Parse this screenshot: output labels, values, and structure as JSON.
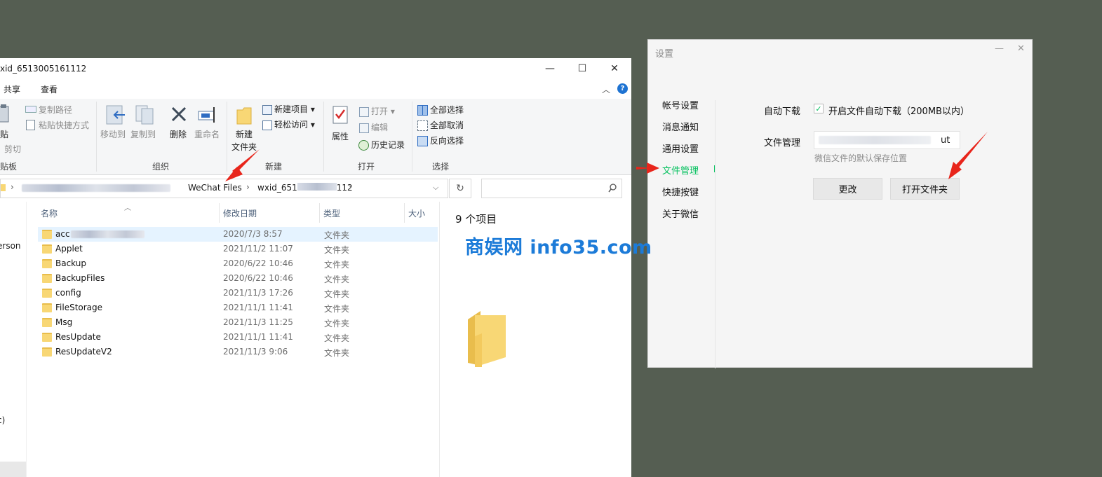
{
  "explorer": {
    "title": "xid_6513005161112",
    "window_controls": [
      "—",
      "☐",
      "✕"
    ],
    "tabs": [
      "共享",
      "查看"
    ],
    "ribbon": {
      "clipboard": {
        "paste": "贴",
        "copy_path": "复制路径",
        "paste_shortcut": "粘贴快捷方式",
        "cut": "剪切",
        "group_label": "贴板"
      },
      "organize": {
        "move_to": "移动到",
        "copy_to": "复制到",
        "delete": "删除",
        "rename": "重命名",
        "group_label": "组织"
      },
      "new": {
        "new_item": "新建项目",
        "easy_access": "轻松访问",
        "new_folder_1": "新建",
        "new_folder_2": "文件夹",
        "group_label": "新建"
      },
      "open": {
        "properties": "属性",
        "open": "打开",
        "edit": "编辑",
        "history": "历史记录",
        "group_label": "打开"
      },
      "select": {
        "select_all": "全部选择",
        "select_none": "全部取消",
        "invert": "反向选择",
        "group_label": "选择"
      }
    },
    "address": {
      "segment_wechat": "WeChat Files",
      "segment_wxid_a": "wxid_651",
      "segment_wxid_b": "112",
      "sep": "›"
    },
    "columns": {
      "name": "名称",
      "date": "修改日期",
      "type": "类型",
      "size": "大小"
    },
    "nav_fragments": [
      "erson",
      "c)"
    ],
    "files": [
      {
        "name": "acc",
        "date": "2020/7/3 8:57",
        "type": "文件夹",
        "selected": true
      },
      {
        "name": "Applet",
        "date": "2021/11/2 11:07",
        "type": "文件夹"
      },
      {
        "name": "Backup",
        "date": "2020/6/22 10:46",
        "type": "文件夹"
      },
      {
        "name": "BackupFiles",
        "date": "2020/6/22 10:46",
        "type": "文件夹"
      },
      {
        "name": "config",
        "date": "2021/11/3 17:26",
        "type": "文件夹"
      },
      {
        "name": "FileStorage",
        "date": "2021/11/1 11:41",
        "type": "文件夹"
      },
      {
        "name": "Msg",
        "date": "2021/11/3 11:25",
        "type": "文件夹"
      },
      {
        "name": "ResUpdate",
        "date": "2021/11/1 11:41",
        "type": "文件夹"
      },
      {
        "name": "ResUpdateV2",
        "date": "2021/11/3 9:06",
        "type": "文件夹"
      }
    ],
    "preview_count": "9 个项目"
  },
  "settings": {
    "title": "设置",
    "controls": [
      "—",
      "✕"
    ],
    "nav": [
      "帐号设置",
      "消息通知",
      "通用设置",
      "文件管理",
      "快捷按键",
      "关于微信"
    ],
    "active_nav": "文件管理",
    "auto_download_label": "自动下载",
    "auto_download_option": "开启文件自动下载（200MB以内）",
    "auto_download_checked": true,
    "file_manage_label": "文件管理",
    "path_suffix": "ut",
    "path_hint": "微信文件的默认保存位置",
    "change_button": "更改",
    "open_folder_button": "打开文件夹"
  },
  "watermark": "商娱网 info35.com",
  "colors": {
    "accent_green": "#07c160",
    "arrow_red": "#e8251b",
    "desktop_bg": "#555e52",
    "watermark_blue": "#1c7bd8"
  }
}
